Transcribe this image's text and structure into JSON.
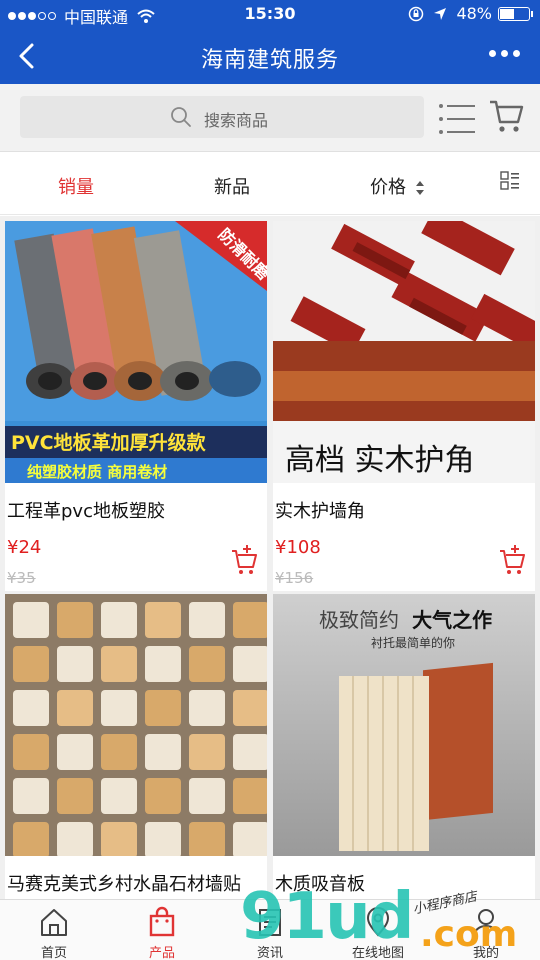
{
  "status": {
    "carrier": "中国联通",
    "time": "15:30",
    "battery": "48%",
    "battery_level": 0.48
  },
  "nav": {
    "title": "海南建筑服务"
  },
  "search": {
    "placeholder": "搜索商品"
  },
  "sort": {
    "sales": "销量",
    "new": "新品",
    "price": "价格"
  },
  "products": [
    {
      "name": "工程革pvc地板塑胶",
      "price": "¥24",
      "old_price": "¥35",
      "img_banner": "PVC地板革加厚升级款",
      "img_sub": "纯塑胶材质 商用卷材",
      "img_tag": "防滑耐磨"
    },
    {
      "name": "实木护墙角",
      "price": "¥108",
      "old_price": "¥156",
      "img_caption": "高档 实木护角"
    },
    {
      "name": "马赛克美式乡村水晶石材墙贴",
      "price": "",
      "old_price": ""
    },
    {
      "name": "木质吸音板",
      "price": "",
      "old_price": "",
      "img_title_a": "极致简约",
      "img_title_b": "大气之作",
      "img_sub": "衬托最简单的你"
    }
  ],
  "tabbar": [
    {
      "label": "首页",
      "icon": "home-icon"
    },
    {
      "label": "产品",
      "icon": "bag-icon"
    },
    {
      "label": "资讯",
      "icon": "news-icon"
    },
    {
      "label": "在线地图",
      "icon": "map-icon"
    },
    {
      "label": "我的",
      "icon": "user-icon"
    }
  ],
  "watermark": {
    "brand": "91ud",
    "domain": ".com",
    "tagline": "小程序商店"
  },
  "colors": {
    "primary": "#1a56c6",
    "accent": "#e03434",
    "price": "#e02020"
  }
}
